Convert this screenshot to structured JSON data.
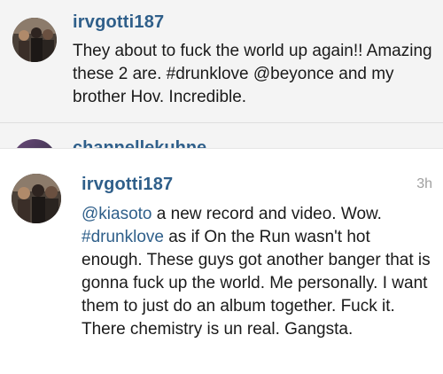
{
  "comments": [
    {
      "username": "irvgotti187",
      "text_parts": [
        {
          "t": "They about to fuck the world up again!! Amazing these 2 are. #drunklove @beyonce and my brother Hov. Incredible.",
          "type": "text"
        }
      ]
    },
    {
      "username": "channellekuhne"
    },
    {
      "username": "irvgotti187",
      "timestamp": "3h",
      "text_parts": [
        {
          "t": "@kiasoto",
          "type": "mention"
        },
        {
          "t": " a new record and video. Wow. ",
          "type": "text"
        },
        {
          "t": "#drunklove",
          "type": "hashtag"
        },
        {
          "t": " as if On the Run wasn't hot enough. These guys got another banger that is gonna fuck up the world. Me personally. I want them to just do an album together. Fuck it. There chemistry is un real. Gangsta.",
          "type": "text"
        }
      ]
    }
  ],
  "colors": {
    "link": "#2f5f8a",
    "text": "#1a1a1a",
    "timestamp": "#a0a0a0",
    "top_bg": "#f4f4f4"
  },
  "icons": {
    "avatar": "profile-photo"
  }
}
